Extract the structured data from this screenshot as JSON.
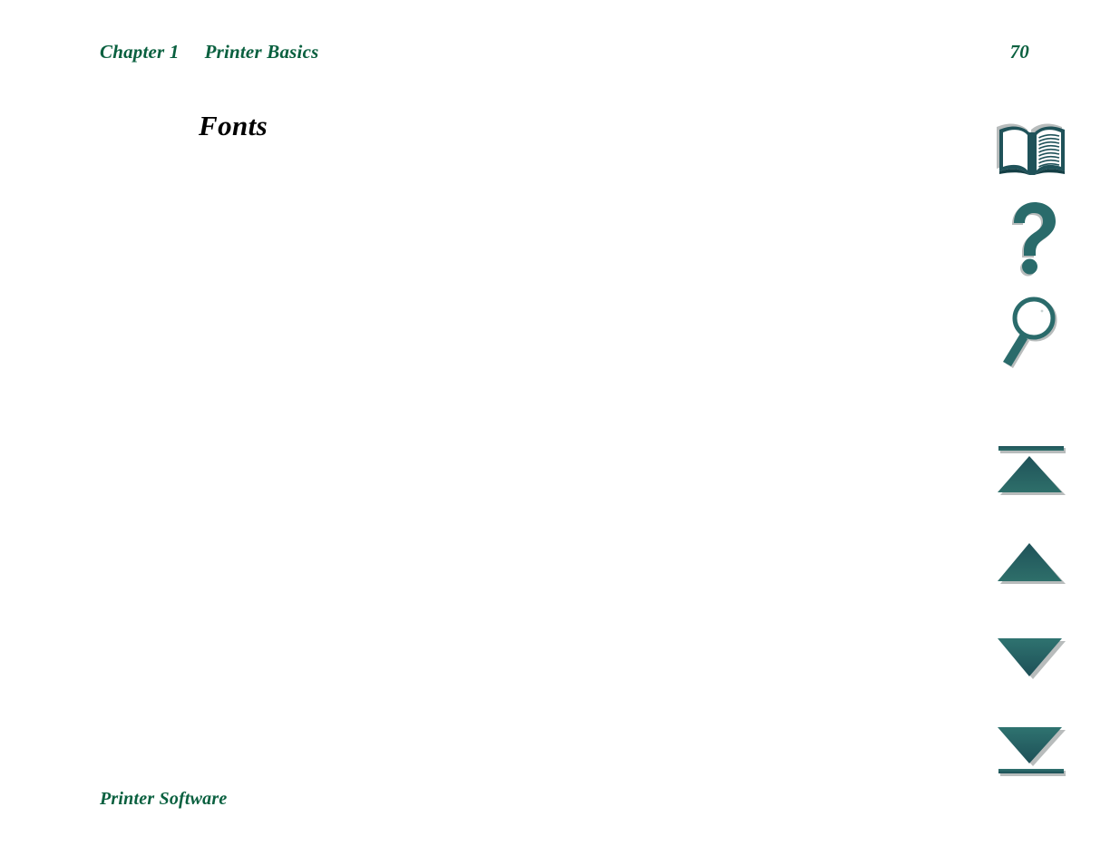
{
  "document": {
    "type": "printer-user-guide-page",
    "background_color": "#ffffff"
  },
  "colors": {
    "heading_green": "#09603f",
    "title_black": "#000000",
    "icon_teal": "#2a6b6b",
    "icon_teal_dark": "#1f5259",
    "icon_teal_light": "#34797a",
    "icon_shadow_gray": "#b8bcbc"
  },
  "header": {
    "chapter_label": "Chapter 1",
    "chapter_title": "Printer Basics",
    "page_number": "70"
  },
  "main": {
    "section_title": "Fonts",
    "body_text": ""
  },
  "footer": {
    "link_label": "Printer Software"
  },
  "nav_rail": {
    "buttons": [
      {
        "id": "book",
        "icon": "open-book-icon",
        "label": "Go to contents"
      },
      {
        "id": "help",
        "icon": "question-mark-icon",
        "label": "Help"
      },
      {
        "id": "search",
        "icon": "magnifying-glass-icon",
        "label": "Search"
      },
      {
        "id": "first",
        "icon": "triangle-up-with-bar-icon",
        "label": "First page"
      },
      {
        "id": "prev",
        "icon": "triangle-up-icon",
        "label": "Previous page"
      },
      {
        "id": "next",
        "icon": "triangle-down-icon",
        "label": "Next page"
      },
      {
        "id": "last",
        "icon": "triangle-down-with-bar-icon",
        "label": "Last page"
      }
    ]
  }
}
